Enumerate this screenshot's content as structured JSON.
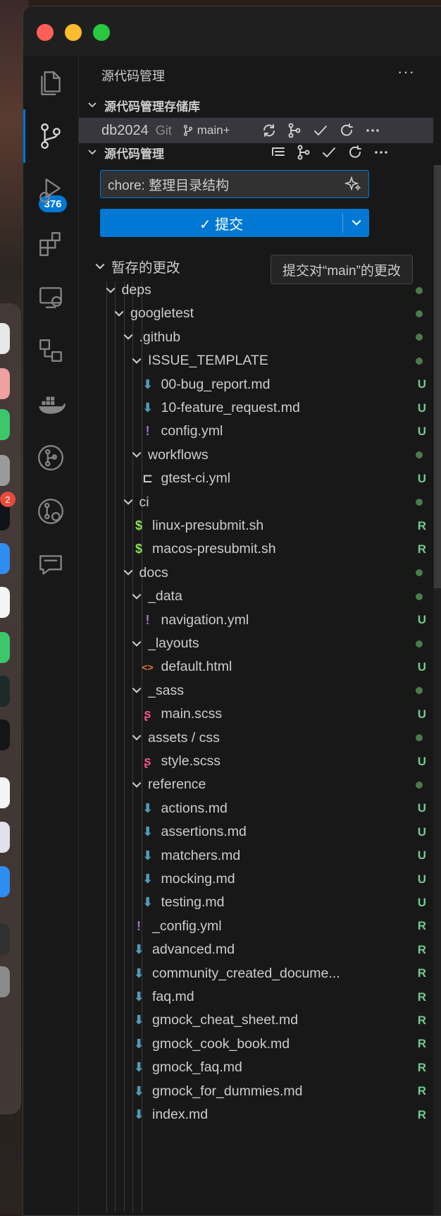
{
  "dock_badge": "2",
  "activity": {
    "scm_badge": "376"
  },
  "sidebar": {
    "header": "源代码管理",
    "more": "···",
    "repos_section": "源代码管理存储库",
    "repo": {
      "name": "db2024",
      "kind": "Git",
      "branch": "main+"
    },
    "scm_section": "源代码管理",
    "commit_message": "chore: 整理目录结构",
    "commit_label": "✓ 提交",
    "tooltip": "提交对“main”的更改",
    "staged_group": "暂存的更改"
  },
  "tree": [
    {
      "label": "deps",
      "type": "folder",
      "depth": 1
    },
    {
      "label": "googletest",
      "type": "folder",
      "depth": 2
    },
    {
      "label": ".github",
      "type": "folder",
      "depth": 3
    },
    {
      "label": "ISSUE_TEMPLATE",
      "type": "folder",
      "depth": 4
    },
    {
      "label": "00-bug_report.md",
      "type": "md",
      "depth": 5,
      "status": "U"
    },
    {
      "label": "10-feature_request.md",
      "type": "md",
      "depth": 5,
      "status": "U"
    },
    {
      "label": "config.yml",
      "type": "yml",
      "depth": 5,
      "status": "U"
    },
    {
      "label": "workflows",
      "type": "folder",
      "depth": 4
    },
    {
      "label": "gtest-ci.yml",
      "type": "ci",
      "depth": 5,
      "status": "U"
    },
    {
      "label": "ci",
      "type": "folder",
      "depth": 3
    },
    {
      "label": "linux-presubmit.sh",
      "type": "sh",
      "depth": 4,
      "status": "R"
    },
    {
      "label": "macos-presubmit.sh",
      "type": "sh",
      "depth": 4,
      "status": "R"
    },
    {
      "label": "docs",
      "type": "folder",
      "depth": 3
    },
    {
      "label": "_data",
      "type": "folder",
      "depth": 4
    },
    {
      "label": "navigation.yml",
      "type": "yml",
      "depth": 5,
      "status": "U"
    },
    {
      "label": "_layouts",
      "type": "folder",
      "depth": 4
    },
    {
      "label": "default.html",
      "type": "html",
      "depth": 5,
      "status": "U"
    },
    {
      "label": "_sass",
      "type": "folder",
      "depth": 4
    },
    {
      "label": "main.scss",
      "type": "scss",
      "depth": 5,
      "status": "U"
    },
    {
      "label": "assets / css",
      "type": "folder",
      "depth": 4
    },
    {
      "label": "style.scss",
      "type": "scss",
      "depth": 5,
      "status": "U"
    },
    {
      "label": "reference",
      "type": "folder",
      "depth": 4
    },
    {
      "label": "actions.md",
      "type": "md",
      "depth": 5,
      "status": "U"
    },
    {
      "label": "assertions.md",
      "type": "md",
      "depth": 5,
      "status": "U"
    },
    {
      "label": "matchers.md",
      "type": "md",
      "depth": 5,
      "status": "U"
    },
    {
      "label": "mocking.md",
      "type": "md",
      "depth": 5,
      "status": "U"
    },
    {
      "label": "testing.md",
      "type": "md",
      "depth": 5,
      "status": "U"
    },
    {
      "label": "_config.yml",
      "type": "yml",
      "depth": 4,
      "status": "R"
    },
    {
      "label": "advanced.md",
      "type": "md",
      "depth": 4,
      "status": "R"
    },
    {
      "label": "community_created_docume...",
      "type": "md",
      "depth": 4,
      "status": "R"
    },
    {
      "label": "faq.md",
      "type": "md",
      "depth": 4,
      "status": "R"
    },
    {
      "label": "gmock_cheat_sheet.md",
      "type": "md",
      "depth": 4,
      "status": "R"
    },
    {
      "label": "gmock_cook_book.md",
      "type": "md",
      "depth": 4,
      "status": "R"
    },
    {
      "label": "gmock_faq.md",
      "type": "md",
      "depth": 4,
      "status": "R"
    },
    {
      "label": "gmock_for_dummies.md",
      "type": "md",
      "depth": 4,
      "status": "R"
    },
    {
      "label": "index.md",
      "type": "md",
      "depth": 4,
      "status": "R"
    }
  ]
}
